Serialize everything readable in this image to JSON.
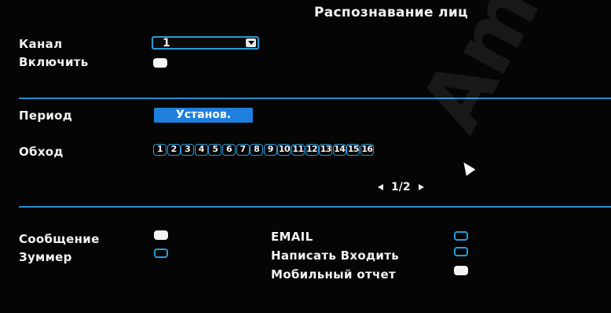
{
  "page_title": "Распознавание лиц",
  "channel": {
    "label": "Канал",
    "selected": "1"
  },
  "enable": {
    "label": "Включить",
    "checked": true
  },
  "period": {
    "label": "Период",
    "button": "Установ."
  },
  "patrol": {
    "label": "Обход",
    "channels": [
      "1",
      "2",
      "3",
      "4",
      "5",
      "6",
      "7",
      "8",
      "9",
      "10",
      "11",
      "12",
      "13",
      "14",
      "15",
      "16"
    ]
  },
  "pager": {
    "current": "1/2"
  },
  "actions": {
    "message": {
      "label": "Сообщение",
      "checked": true
    },
    "buzzer": {
      "label": "Зуммер",
      "checked": false
    },
    "email": {
      "label": "EMAIL",
      "checked": false
    },
    "write_input": {
      "label": "Написать Входить",
      "checked": false
    },
    "mobile_report": {
      "label": "Мобильный отчет",
      "checked": true
    }
  },
  "watermark": "Ama",
  "colors": {
    "accent": "#1e8fd1",
    "button": "#1f7fdc"
  }
}
